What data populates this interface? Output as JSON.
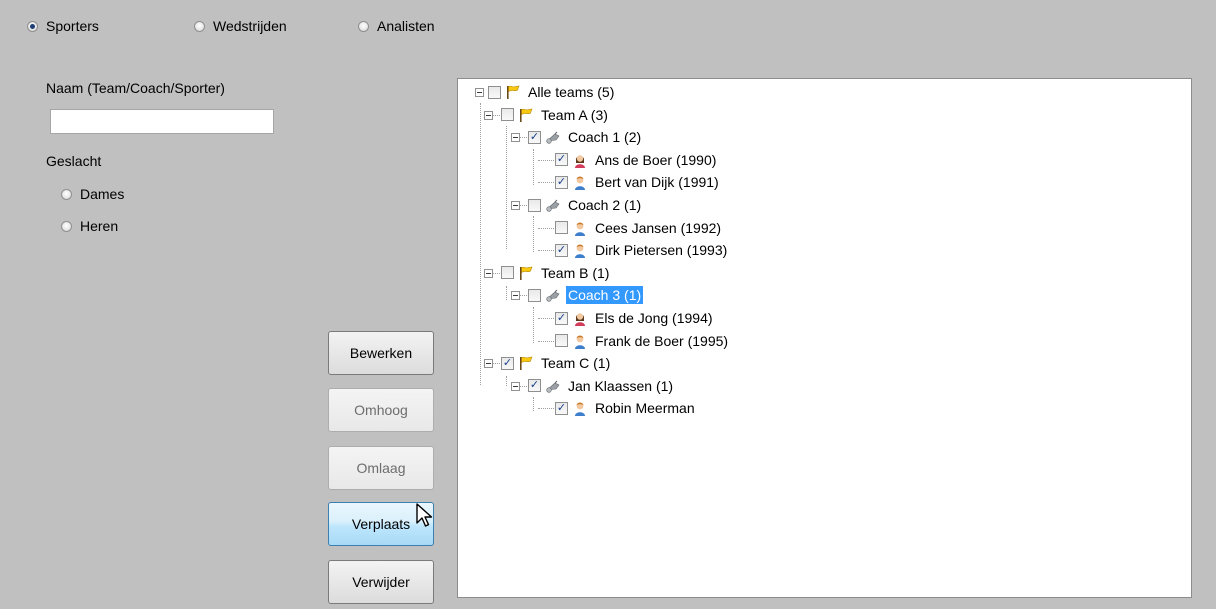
{
  "mode_radios": [
    {
      "label": "Sporters",
      "checked": true
    },
    {
      "label": "Wedstrijden",
      "checked": false
    },
    {
      "label": "Analisten",
      "checked": false
    }
  ],
  "filter": {
    "name_label": "Naam (Team/Coach/Sporter)",
    "name_value": "",
    "gender_label": "Geslacht",
    "gender_options": [
      "Dames",
      "Heren"
    ]
  },
  "buttons": {
    "edit": "Bewerken",
    "up": "Omhoog",
    "down": "Omlaag",
    "move": "Verplaats",
    "delete": "Verwijder"
  },
  "tree": [
    {
      "label": "Alle teams (5)",
      "checked": false,
      "icon": "flag-icon",
      "level": 0
    },
    {
      "label": "Team A (3)",
      "checked": false,
      "icon": "flag-icon",
      "level": 1
    },
    {
      "label": "Coach 1 (2)",
      "checked": true,
      "icon": "whistle-icon",
      "level": 2
    },
    {
      "label": "Ans de Boer (1990)",
      "checked": true,
      "icon": "female-user-icon",
      "level": 3
    },
    {
      "label": "Bert van Dijk (1991)",
      "checked": true,
      "icon": "male-user-icon",
      "level": 3
    },
    {
      "label": "Coach 2 (1)",
      "checked": false,
      "icon": "whistle-icon",
      "level": 2
    },
    {
      "label": "Cees Jansen (1992)",
      "checked": false,
      "icon": "male-user-icon",
      "level": 3
    },
    {
      "label": "Dirk Pietersen (1993)",
      "checked": true,
      "icon": "male-user-icon",
      "level": 3
    },
    {
      "label": "Team B (1)",
      "checked": false,
      "icon": "flag-icon",
      "level": 1
    },
    {
      "label": "Coach 3 (1)",
      "checked": false,
      "icon": "whistle-icon",
      "level": 2,
      "selected": true
    },
    {
      "label": "Els de Jong (1994)",
      "checked": true,
      "icon": "female-user-icon",
      "level": 3
    },
    {
      "label": "Frank de Boer (1995)",
      "checked": false,
      "icon": "male-user-icon",
      "level": 3
    },
    {
      "label": "Team C (1)",
      "checked": true,
      "icon": "flag-icon",
      "level": 1
    },
    {
      "label": "Jan Klaassen (1)",
      "checked": true,
      "icon": "whistle-icon",
      "level": 2
    },
    {
      "label": "Robin Meerman",
      "checked": true,
      "icon": "male-user-icon",
      "level": 3
    }
  ],
  "colors": {
    "selection": "#3399ff",
    "background": "#c0c0c0",
    "button_hover": "#bee6fd"
  }
}
